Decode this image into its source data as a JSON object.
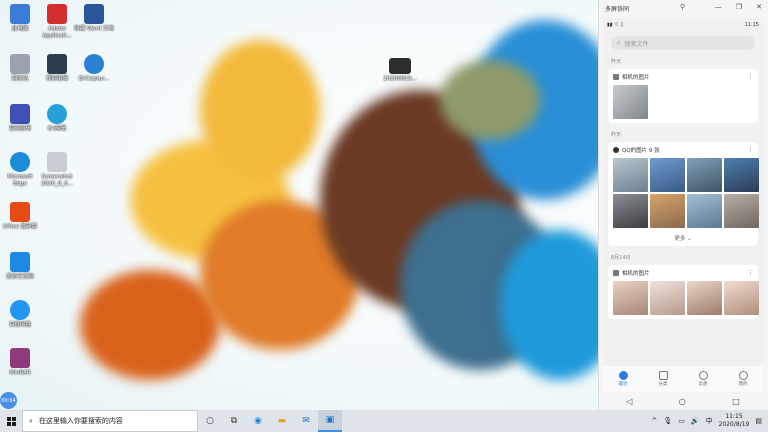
{
  "desktop": {
    "icons": [
      {
        "label": "此电脑",
        "color": "#3b7bd6"
      },
      {
        "label": "Adobe Applicati...",
        "color": "#d32f2f"
      },
      {
        "label": "新建 Word 文档",
        "color": "#2b579a"
      },
      {
        "label": "回收站",
        "color": "#9aa4b0"
      },
      {
        "label": "视频编辑",
        "color": "#2c3e50"
      },
      {
        "label": "EVCaptur...",
        "color": "#2d7fd4"
      },
      {
        "label": "音频剪辑",
        "color": "#3f51b5"
      },
      {
        "label": "EV剪辑",
        "color": "#29a0d8"
      },
      {
        "label": "Microsoft Edge",
        "color": "#1a8cd8"
      },
      {
        "label": "Screenshot 2020_8_6...",
        "color": "#c9ced4"
      },
      {
        "label": "Office 最新版",
        "color": "#e64a19"
      },
      {
        "label": "爱奇艺视频",
        "color": "#1e88e5"
      },
      {
        "label": "百度网盘",
        "color": "#2196f3"
      },
      {
        "label": "WinRAR",
        "color": "#8d3b7a"
      }
    ],
    "video_file_label": "20200819...",
    "wallpaper_colors": {
      "orange": "#e67e22",
      "yellow": "#f6c141",
      "blue": "#2a8fd6",
      "brown": "#4a2c1f"
    }
  },
  "panel": {
    "title": "多屏协同",
    "status_time": "11:15",
    "search_placeholder": "搜索文件",
    "date_label_1": "昨天",
    "card1": {
      "title": "相机的图片"
    },
    "date_label_2": "昨天",
    "card2": {
      "title": "QQ的图片 9 张",
      "more_label": "更多"
    },
    "date_label_3": "8月14日",
    "card3": {
      "title": "相机的图片"
    },
    "nav": [
      {
        "label": "最近"
      },
      {
        "label": "分类"
      },
      {
        "label": "云盘"
      },
      {
        "label": "我的"
      }
    ],
    "accent": "#2a7ae2"
  },
  "taskbar": {
    "search_placeholder": "在这里输入你要搜索的内容",
    "time": "11:15",
    "date": "2020/8/19",
    "ime": "中",
    "bubble_text": "00:04"
  }
}
